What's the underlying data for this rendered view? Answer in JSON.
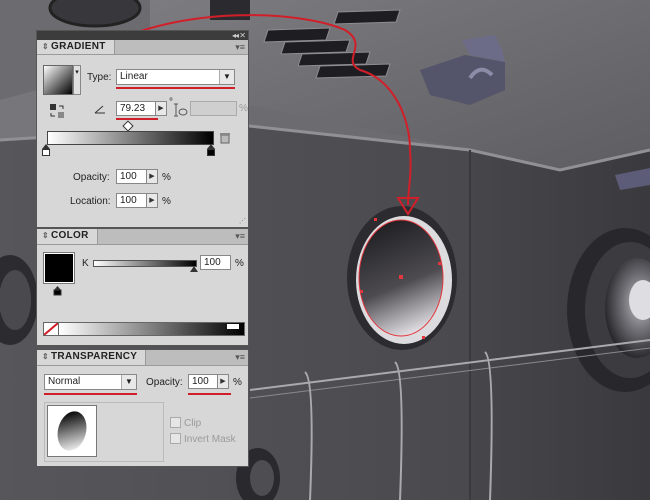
{
  "gradient_panel": {
    "title": "GRADIENT",
    "type_label": "Type:",
    "type_value": "Linear",
    "angle_value": "79.23",
    "degree_symbol": "°",
    "aspect_unit": "%",
    "opacity_label": "Opacity:",
    "opacity_value": "100",
    "opacity_unit": "%",
    "location_label": "Location:",
    "location_value": "100",
    "location_unit": "%"
  },
  "color_panel": {
    "title": "COLOR",
    "channel_label": "K",
    "channel_value": "100",
    "channel_unit": "%"
  },
  "transparency_panel": {
    "title": "TRANSPARENCY",
    "blend_mode": "Normal",
    "opacity_label": "Opacity:",
    "opacity_value": "100",
    "opacity_unit": "%",
    "clip_label": "Clip",
    "invert_mask_label": "Invert Mask"
  },
  "colors": {
    "annotation_red": "#d11f2a",
    "panel_bg": "#d7d7d7",
    "panel_dark": "#3c3c3c"
  }
}
